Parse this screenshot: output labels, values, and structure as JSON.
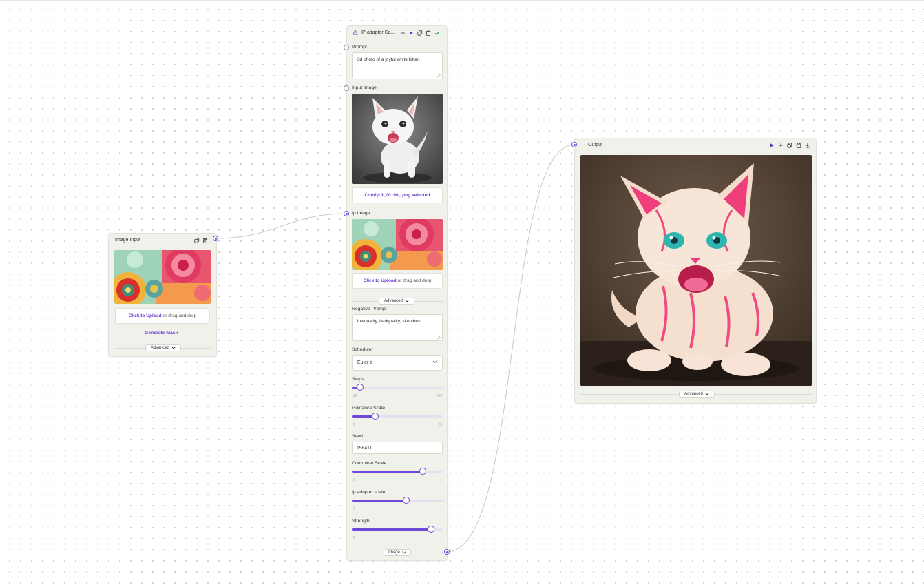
{
  "colors": {
    "accent": "#6e49d6",
    "node_bg": "#f1f1ec",
    "wire": "#c8c8c8"
  },
  "image_input_node": {
    "title": "Image Input",
    "upload_link": "Click to Upload",
    "upload_rest": "or drag and drop",
    "generate_mask": "Generate Mask",
    "advanced": "Advanced"
  },
  "ip_adapter_node": {
    "title": "IP-adapter Ca...",
    "prompt_label": "Prompt",
    "prompt_value": "3d photo of a joyful white kitten",
    "input_image_label": "Input Image",
    "input_image_selected": "ComfyUI_00196_.png selected",
    "ip_image_label": "Ip Image",
    "upload_link": "Click to Upload",
    "upload_rest": "or drag and drop",
    "advanced": "Advanced",
    "negative_prompt_label": "Negative Prompt",
    "negative_prompt_value": "lowquality, badquality, sketches",
    "scheduler_label": "Scheduler",
    "scheduler_value": "Euler a",
    "steps": {
      "label": "Steps",
      "min": "20",
      "max": "100",
      "value_fraction": 0.09
    },
    "guidance": {
      "label": "Guidance Scale",
      "min": "1",
      "max": "25",
      "value_fraction": 0.26
    },
    "seed_label": "Seed",
    "seed_value": "158411",
    "controlnet": {
      "label": "Controlnet Scale",
      "min": "0",
      "max": "1",
      "value_fraction": 0.78
    },
    "ip_adapter_scale": {
      "label": "Ip adapter scale",
      "min": "0",
      "max": "1",
      "value_fraction": 0.6
    },
    "strength": {
      "label": "Strength",
      "min": "0",
      "max": "1",
      "value_fraction": 0.87
    },
    "output_type": "Image"
  },
  "output_node": {
    "title": "Output",
    "advanced": "Advanced"
  }
}
